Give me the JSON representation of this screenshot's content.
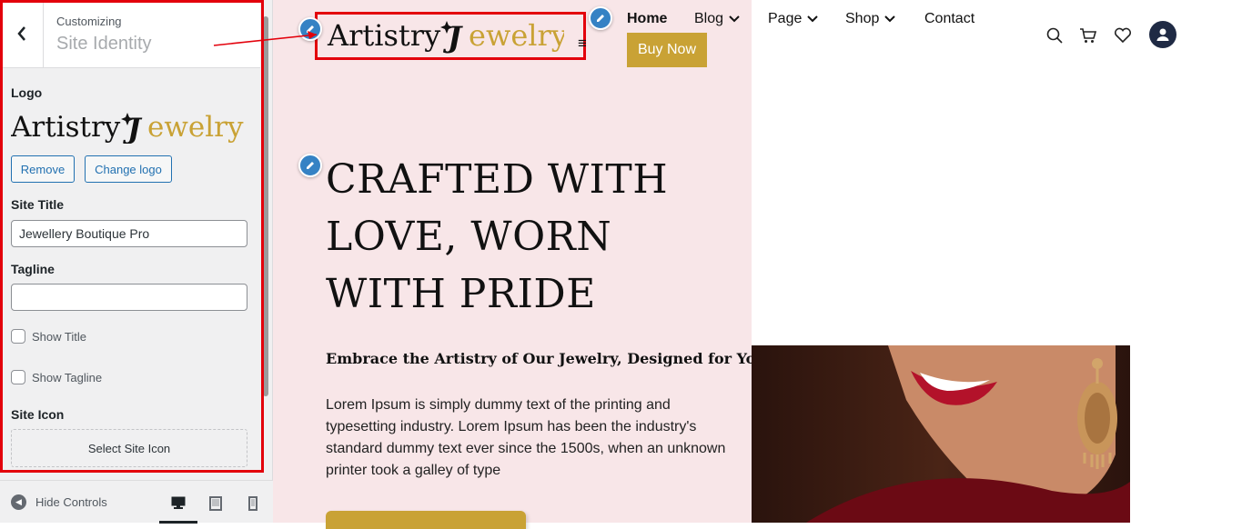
{
  "customizer": {
    "back_label": "‹",
    "label": "Customizing",
    "title": "Site Identity",
    "logo_label": "Logo",
    "logo_text_dark": "Artistry",
    "logo_text_gold": "ewelry",
    "logo_monogram": "J",
    "remove_button": "Remove",
    "change_logo_button": "Change logo",
    "site_title_label": "Site Title",
    "site_title_value": "Jewellery Boutique Pro",
    "tagline_label": "Tagline",
    "tagline_value": "",
    "show_title_label": "Show Title",
    "show_tagline_label": "Show Tagline",
    "site_icon_label": "Site Icon",
    "select_site_icon_button": "Select Site Icon",
    "hide_controls_label": "Hide Controls",
    "devices": [
      "desktop",
      "tablet",
      "mobile"
    ],
    "active_device": "desktop"
  },
  "site": {
    "logo_text_dark": "Artistry",
    "logo_text_gold": "ewelry",
    "logo_monogram": "J",
    "nav": [
      {
        "label": "Home",
        "active": true,
        "dropdown": false
      },
      {
        "label": "Blog",
        "active": false,
        "dropdown": true
      },
      {
        "label": "Page",
        "active": false,
        "dropdown": true
      },
      {
        "label": "Shop",
        "active": false,
        "dropdown": true
      },
      {
        "label": "Contact",
        "active": false,
        "dropdown": false
      }
    ],
    "buy_now": "Buy Now",
    "hero_title": "CRAFTED WITH LOVE, WORN WITH PRIDE",
    "hero_subtitle": "Embrace the Artistry of Our Jewelry, Designed for You",
    "hero_body": "Lorem Ipsum is simply dummy text of the printing and typesetting industry. Lorem Ipsum has been the industry's standard dummy text ever since the 1500s, when an unknown printer took a galley of type",
    "header_icons": [
      "search-icon",
      "cart-icon",
      "heart-icon",
      "user-icon"
    ]
  },
  "colors": {
    "brand_gold": "#c9a235",
    "hero_bg": "#f8e6e8",
    "wp_blue": "#2271b1",
    "annotation_red": "#e3000b",
    "edit_pencil": "#3582c4"
  }
}
